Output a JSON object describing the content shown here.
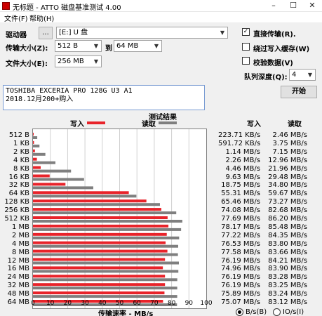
{
  "window": {
    "title": "无标题 - ATTO 磁盘基准测试 4.00"
  },
  "menu": {
    "file": "文件(F)",
    "help": "帮助(H)"
  },
  "drive": {
    "label": "驱动器",
    "browse_label": "...",
    "value": "[E:] U 盘"
  },
  "transfer": {
    "label": "传输大小(Z):",
    "from": "512 B",
    "to_label": "到",
    "to": "64 MB"
  },
  "file_size": {
    "label": "文件大小(E):",
    "value": "256 MB"
  },
  "options": {
    "direct_io": {
      "label": "直接传输(R).",
      "checked": true
    },
    "bypass_cache": {
      "label": "绕过写入缓存(W)",
      "checked": false
    },
    "verify": {
      "label": "校验数据(V)",
      "checked": false
    },
    "queue_label": "队列深度(Q):",
    "queue_value": "4"
  },
  "start_label": "开始",
  "description": {
    "line1": "TOSHIBA EXCERIA PRO 128G U3 A1",
    "line2": "2018.12月200+购入"
  },
  "results": {
    "title": "测试结果",
    "write_label": "写入",
    "read_label": "读取",
    "write_color": "#e8232a",
    "read_color": "#7f7f7f",
    "xaxis_label": "传输速率 - MB/s",
    "ticks": [
      "0",
      "10",
      "20",
      "30",
      "40",
      "50",
      "60",
      "70",
      "80",
      "90",
      "100"
    ]
  },
  "chart_data": {
    "type": "bar",
    "title": "测试结果",
    "xlabel": "传输速率 - MB/s",
    "xlim": [
      0,
      100
    ],
    "categories": [
      "512 B",
      "1 KB",
      "2 KB",
      "4 KB",
      "8 KB",
      "16 KB",
      "32 KB",
      "64 KB",
      "128 KB",
      "256 KB",
      "512 KB",
      "1 MB",
      "2 MB",
      "4 MB",
      "8 MB",
      "12 MB",
      "16 MB",
      "24 MB",
      "32 MB",
      "48 MB",
      "64 MB"
    ],
    "series": [
      {
        "name": "写入",
        "values": [
          0.22,
          0.58,
          1.14,
          2.26,
          4.46,
          9.63,
          18.75,
          55.31,
          65.46,
          74.08,
          77.69,
          78.17,
          77.22,
          76.53,
          77.58,
          76.19,
          74.96,
          76.19,
          76.19,
          75.89,
          75.07
        ]
      },
      {
        "name": "读取",
        "values": [
          2.46,
          3.75,
          7.15,
          12.96,
          21.96,
          29.48,
          34.8,
          59.67,
          73.27,
          82.68,
          86.2,
          85.48,
          84.35,
          83.8,
          83.66,
          84.21,
          83.9,
          83.28,
          83.25,
          83.24,
          83.12
        ]
      }
    ],
    "write_text": [
      "223.71 KB/s",
      "591.72 KB/s",
      "1.14 MB/s",
      "2.26 MB/s",
      "4.46 MB/s",
      "9.63 MB/s",
      "18.75 MB/s",
      "55.31 MB/s",
      "65.46 MB/s",
      "74.08 MB/s",
      "77.69 MB/s",
      "78.17 MB/s",
      "77.22 MB/s",
      "76.53 MB/s",
      "77.58 MB/s",
      "76.19 MB/s",
      "74.96 MB/s",
      "76.19 MB/s",
      "76.19 MB/s",
      "75.89 MB/s",
      "75.07 MB/s"
    ],
    "read_text": [
      "2.46 MB/s",
      "3.75 MB/s",
      "7.15 MB/s",
      "12.96 MB/s",
      "21.96 MB/s",
      "29.48 MB/s",
      "34.80 MB/s",
      "59.67 MB/s",
      "73.27 MB/s",
      "82.68 MB/s",
      "86.20 MB/s",
      "85.48 MB/s",
      "84.35 MB/s",
      "83.80 MB/s",
      "83.66 MB/s",
      "84.21 MB/s",
      "83.90 MB/s",
      "83.28 MB/s",
      "83.25 MB/s",
      "83.24 MB/s",
      "83.12 MB/s"
    ]
  },
  "units": {
    "bs_label": "B/s(B)",
    "ios_label": "IO/s(I)",
    "selected": "bs"
  }
}
